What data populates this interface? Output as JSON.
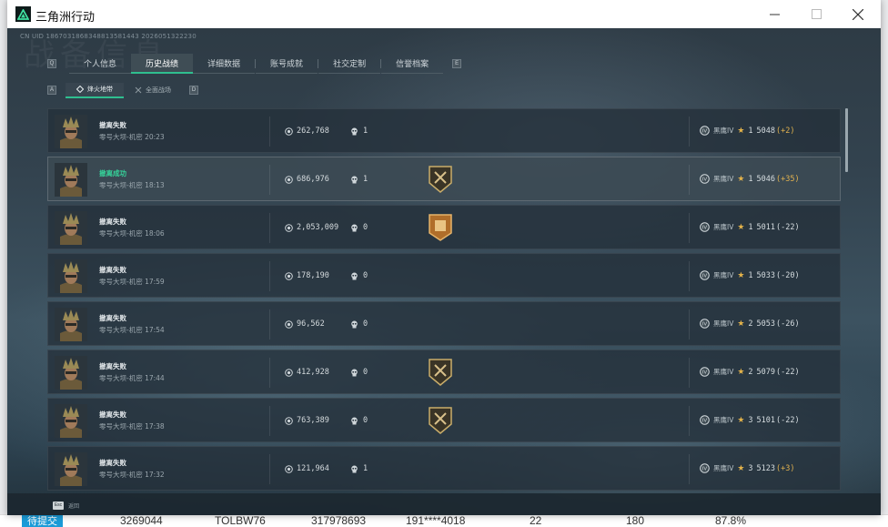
{
  "app": {
    "title": "三角洲行动"
  },
  "header": {
    "uid": "CN UID 1867031868348813581443 2026051322230",
    "watermark": "战备信息"
  },
  "tabs": [
    {
      "key": "Q"
    },
    {
      "label": "个人信息"
    },
    {
      "label": "历史战绩",
      "active": true
    },
    {
      "label": "详细数据"
    },
    {
      "label": "账号成就"
    },
    {
      "label": "社交定制"
    },
    {
      "label": "信誉档案"
    },
    {
      "key": "E"
    }
  ],
  "subtabs": {
    "left_key": "A",
    "right_key": "D",
    "items": [
      {
        "label": "烽火地带",
        "active": true
      },
      {
        "label": "全面战场"
      }
    ]
  },
  "matches": [
    {
      "status": "撤离失败",
      "success": false,
      "map": "零号大坝-机密 20:23",
      "coins": "262,768",
      "kills": "1",
      "badge": null,
      "rank": "黑鹰IV",
      "stars": "1",
      "score": "5048",
      "delta": "(+2)"
    },
    {
      "status": "撤离成功",
      "success": true,
      "map": "零号大坝-机密 18:13",
      "coins": "686,976",
      "kills": "1",
      "badge": "shield",
      "rank": "黑鹰IV",
      "stars": "1",
      "score": "5046",
      "delta": "(+35)"
    },
    {
      "status": "撤离失败",
      "success": false,
      "map": "零号大坝-机密 18:06",
      "coins": "2,053,009",
      "kills": "0",
      "badge": "gold",
      "rank": "黑鹰IV",
      "stars": "1",
      "score": "5011",
      "delta": "(-22)"
    },
    {
      "status": "撤离失败",
      "success": false,
      "map": "零号大坝-机密 17:59",
      "coins": "178,190",
      "kills": "0",
      "badge": null,
      "rank": "黑鹰IV",
      "stars": "1",
      "score": "5033",
      "delta": "(-20)"
    },
    {
      "status": "撤离失败",
      "success": false,
      "map": "零号大坝-机密 17:54",
      "coins": "96,562",
      "kills": "0",
      "badge": null,
      "rank": "黑鹰IV",
      "stars": "2",
      "score": "5053",
      "delta": "(-26)"
    },
    {
      "status": "撤离失败",
      "success": false,
      "map": "零号大坝-机密 17:44",
      "coins": "412,928",
      "kills": "0",
      "badge": "shield",
      "rank": "黑鹰IV",
      "stars": "2",
      "score": "5079",
      "delta": "(-22)"
    },
    {
      "status": "撤离失败",
      "success": false,
      "map": "零号大坝-机密 17:38",
      "coins": "763,389",
      "kills": "0",
      "badge": "shield",
      "rank": "黑鹰IV",
      "stars": "3",
      "score": "5101",
      "delta": "(-22)"
    },
    {
      "status": "撤离失败",
      "success": false,
      "map": "零号大坝-机密 17:32",
      "coins": "121,964",
      "kills": "1",
      "badge": null,
      "rank": "黑鹰IV",
      "stars": "3",
      "score": "5123",
      "delta": "(+3)"
    }
  ],
  "footer": {
    "esc_key": "Esc",
    "esc_label": "返回"
  },
  "background_table": {
    "tag": "待提交",
    "cells": [
      "3269044",
      "TOLBW76",
      "317978693",
      "191****4018",
      "22",
      "180",
      "87.8%"
    ]
  },
  "colors": {
    "accent": "#2fbf8f",
    "success": "#36d39a",
    "star": "#e2b24a"
  }
}
